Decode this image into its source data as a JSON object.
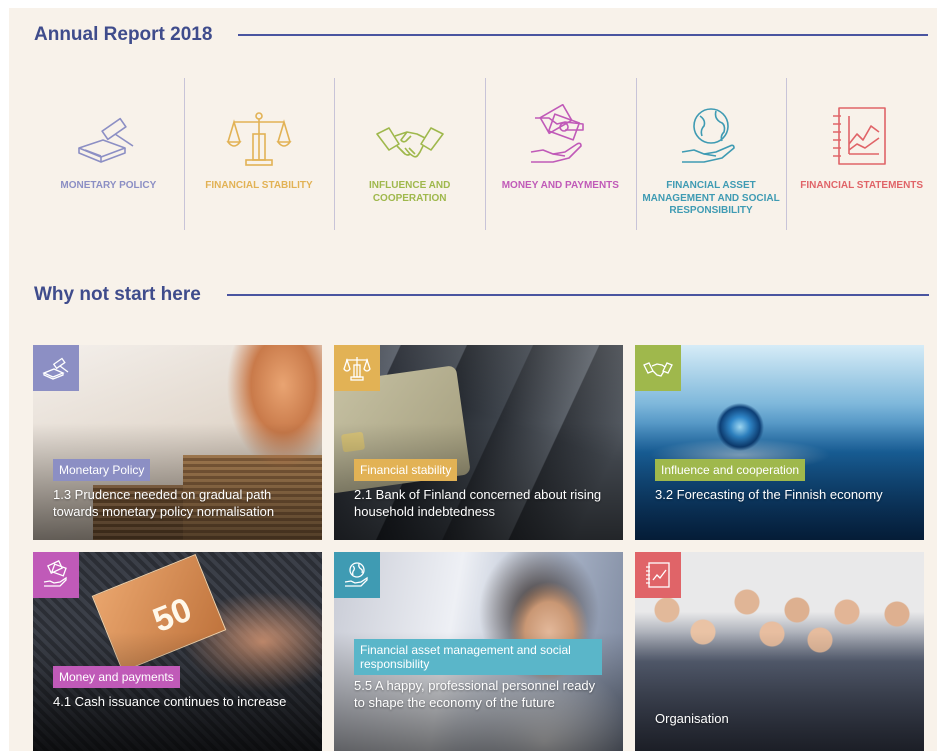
{
  "header": {
    "title": "Annual Report 2018"
  },
  "categories": [
    {
      "label": "MONETARY POLICY",
      "color": "#8c8fc4",
      "icon": "gavel-icon"
    },
    {
      "label": "FINANCIAL STABILITY",
      "color": "#e2b255",
      "icon": "scales-icon"
    },
    {
      "label": "INFLUENCE AND COOPERATION",
      "color": "#9fb84c",
      "icon": "handshake-icon"
    },
    {
      "label": "MONEY AND PAYMENTS",
      "color": "#c05ab8",
      "icon": "money-hands-icon"
    },
    {
      "label": "FINANCIAL ASSET MANAGEMENT AND SOCIAL RESPONSIBILITY",
      "color": "#3f9bb3",
      "icon": "globe-hand-icon"
    },
    {
      "label": "FINANCIAL STATEMENTS",
      "color": "#e06468",
      "icon": "chart-document-icon"
    }
  ],
  "section2": {
    "title": "Why not start here"
  },
  "cards": [
    {
      "tag": "Monetary Policy",
      "title": "1.3 Prudence needed on gradual path towards monetary policy normalisation",
      "color": "#8c8fc4",
      "icon": "gavel-icon"
    },
    {
      "tag": "Financial stability",
      "title": "2.1 Bank of Finland concerned about rising household indebtedness",
      "color": "#e2b255",
      "icon": "scales-icon"
    },
    {
      "tag": "Influence and cooperation",
      "title": "3.2 Forecasting of the Finnish economy",
      "color": "#9fb84c",
      "icon": "handshake-icon"
    },
    {
      "tag": "Money and payments",
      "title": "4.1 Cash issuance continues to increase",
      "color": "#c05ab8",
      "icon": "money-hands-icon"
    },
    {
      "tag": "Financial asset management and social responsibility",
      "title": "5.5 A happy, professional personnel ready to shape the economy of the future",
      "color": "#3f9bb3",
      "icon": "globe-hand-icon"
    },
    {
      "tag": "",
      "title": "Organisation",
      "color": "#e06468",
      "icon": "chart-document-icon"
    }
  ]
}
